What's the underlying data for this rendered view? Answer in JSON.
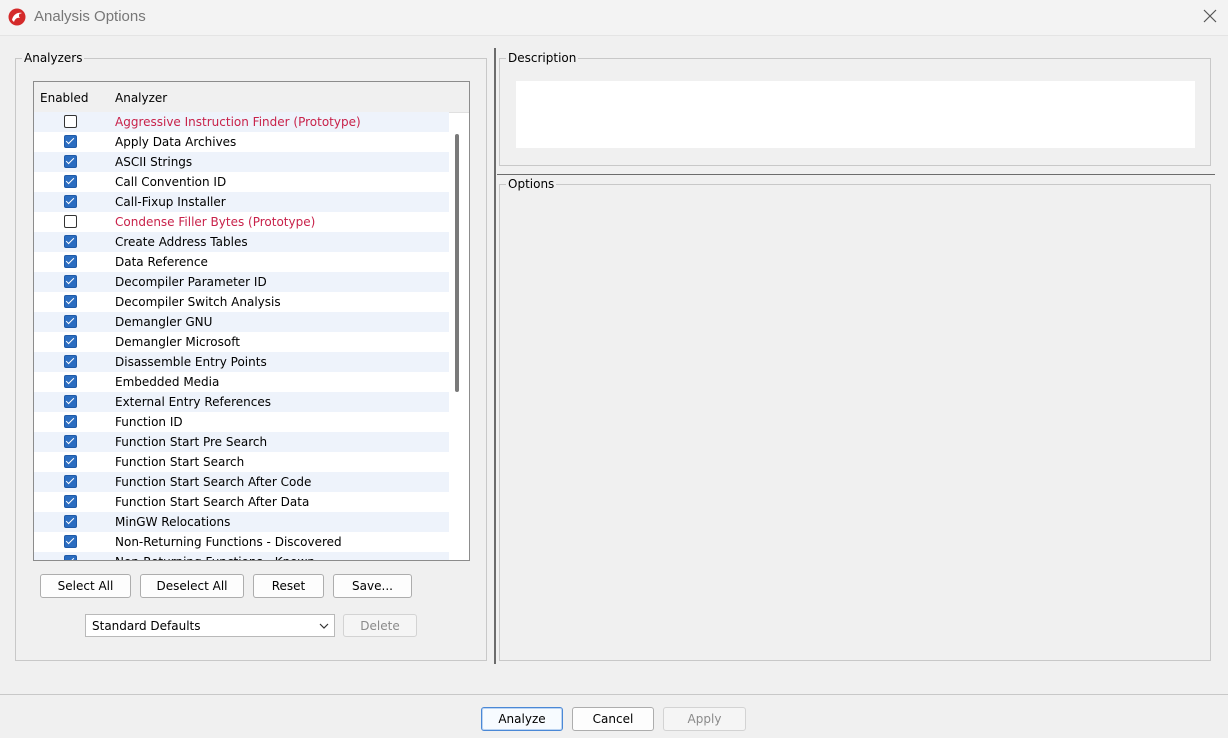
{
  "window": {
    "title": "Analysis Options"
  },
  "analyzers": {
    "group_label": "Analyzers",
    "columns": {
      "enabled": "Enabled",
      "analyzer": "Analyzer"
    },
    "rows": [
      {
        "name": "Aggressive Instruction Finder (Prototype)",
        "enabled": false,
        "prototype": true
      },
      {
        "name": "Apply Data Archives",
        "enabled": true,
        "prototype": false
      },
      {
        "name": "ASCII Strings",
        "enabled": true,
        "prototype": false
      },
      {
        "name": "Call Convention ID",
        "enabled": true,
        "prototype": false
      },
      {
        "name": "Call-Fixup Installer",
        "enabled": true,
        "prototype": false
      },
      {
        "name": "Condense Filler Bytes (Prototype)",
        "enabled": false,
        "prototype": true
      },
      {
        "name": "Create Address Tables",
        "enabled": true,
        "prototype": false
      },
      {
        "name": "Data Reference",
        "enabled": true,
        "prototype": false
      },
      {
        "name": "Decompiler Parameter ID",
        "enabled": true,
        "prototype": false
      },
      {
        "name": "Decompiler Switch Analysis",
        "enabled": true,
        "prototype": false
      },
      {
        "name": "Demangler GNU",
        "enabled": true,
        "prototype": false
      },
      {
        "name": "Demangler Microsoft",
        "enabled": true,
        "prototype": false
      },
      {
        "name": "Disassemble Entry Points",
        "enabled": true,
        "prototype": false
      },
      {
        "name": "Embedded Media",
        "enabled": true,
        "prototype": false
      },
      {
        "name": "External Entry References",
        "enabled": true,
        "prototype": false
      },
      {
        "name": "Function ID",
        "enabled": true,
        "prototype": false
      },
      {
        "name": "Function Start Pre Search",
        "enabled": true,
        "prototype": false
      },
      {
        "name": "Function Start Search",
        "enabled": true,
        "prototype": false
      },
      {
        "name": "Function Start Search After Code",
        "enabled": true,
        "prototype": false
      },
      {
        "name": "Function Start Search After Data",
        "enabled": true,
        "prototype": false
      },
      {
        "name": "MinGW Relocations",
        "enabled": true,
        "prototype": false
      },
      {
        "name": "Non-Returning Functions - Discovered",
        "enabled": true,
        "prototype": false
      },
      {
        "name": "Non-Returning Functions - Known",
        "enabled": true,
        "prototype": false
      }
    ],
    "buttons": {
      "select_all": "Select All",
      "deselect_all": "Deselect All",
      "reset": "Reset",
      "save": "Save..."
    },
    "profile": {
      "selected": "Standard Defaults",
      "delete_label": "Delete"
    }
  },
  "description": {
    "group_label": "Description",
    "text": ""
  },
  "options": {
    "group_label": "Options"
  },
  "footer": {
    "analyze": "Analyze",
    "cancel": "Cancel",
    "apply": "Apply"
  },
  "colors": {
    "prototype_text": "#c8224a",
    "checkbox_checked": "#2a6cc0",
    "row_stripe": "#eef3fb"
  }
}
